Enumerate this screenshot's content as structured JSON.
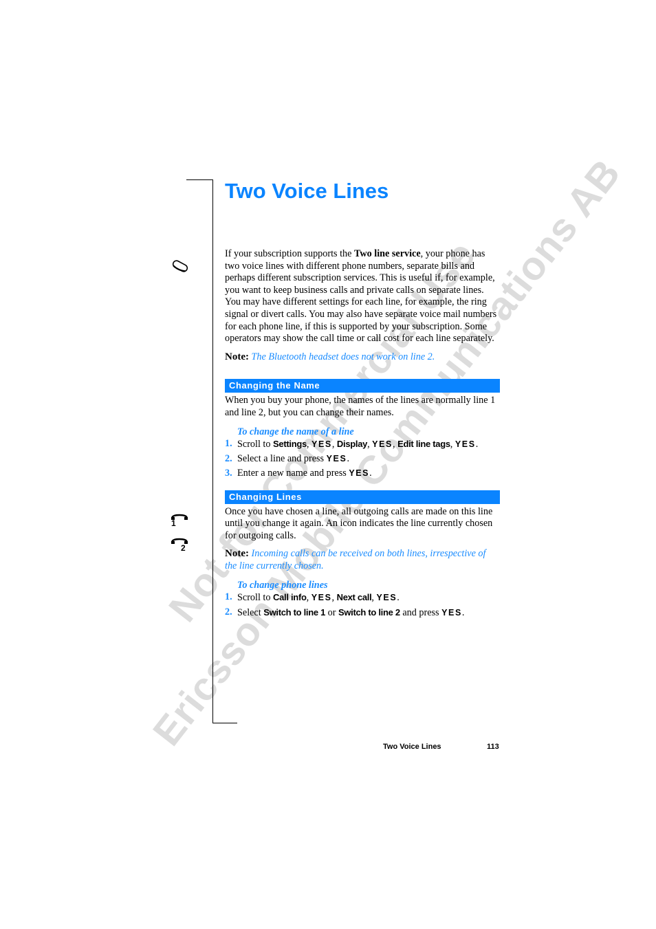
{
  "watermark": {
    "line1": "Not for Commercial Use",
    "line2": "Ericsson Mobile Communications AB"
  },
  "page": {
    "title": "Two Voice Lines"
  },
  "intro": {
    "text_before": "If your subscription supports the ",
    "bold": "Two line service",
    "text_after": ", your phone has two voice lines with different phone numbers, separate bills and perhaps different subscription services. This is useful if, for example, you want to keep business calls and private calls on separate lines. You may have different settings for each line, for example, the ring signal or divert calls. You may also have separate voice mail numbers for each phone line, if this is supported by your subscription. Some operators may show the call time or call cost for each line separately.",
    "note_label": "Note:",
    "note_text": "The Bluetooth headset does not work on line 2."
  },
  "sections": [
    {
      "heading": "Changing the Name",
      "body": "When you buy your phone, the names of the lines are normally line 1 and line 2, but you can change their names.",
      "procedure_title": "To change the name of a line",
      "steps": [
        {
          "num": "1.",
          "parts": [
            "Scroll to ",
            "Settings",
            ", ",
            "YES",
            ", ",
            "Display",
            ", ",
            "YES",
            ", ",
            "Edit line tags",
            ", ",
            "YES",
            "."
          ]
        },
        {
          "num": "2.",
          "parts": [
            "Select a line and press ",
            "YES",
            "."
          ]
        },
        {
          "num": "3.",
          "parts": [
            "Enter a new name and press ",
            "YES",
            "."
          ]
        }
      ]
    },
    {
      "heading": "Changing Lines",
      "body": "Once you have chosen a line, all outgoing calls are made on this line until you change it again. An icon indicates the line currently chosen for outgoing calls.",
      "note_label": "Note:",
      "note_text": "Incoming calls can be received on both lines, irrespective of the line currently chosen.",
      "procedure_title": "To change phone lines",
      "steps": [
        {
          "num": "1.",
          "parts": [
            "Scroll to ",
            "Call info",
            ", ",
            "YES",
            ", ",
            "Next call",
            ", ",
            "YES",
            "."
          ]
        },
        {
          "num": "2.",
          "parts": [
            "Select ",
            "Switch to line 1",
            " or ",
            "Switch to line 2",
            " and press ",
            "YES",
            "."
          ]
        }
      ]
    }
  ],
  "icons": {
    "margin_icon_1": "phone-handset-icon",
    "line1_icon": "line-1-icon",
    "line1_digit": "1",
    "line2_icon": "line-2-icon",
    "line2_digit": "2"
  },
  "footer": {
    "section_title": "Two Voice Lines",
    "page_number": "113"
  },
  "colors": {
    "accent": "#0a84ff",
    "note_text": "#1a8cff",
    "watermark": "#dcdcdc"
  }
}
